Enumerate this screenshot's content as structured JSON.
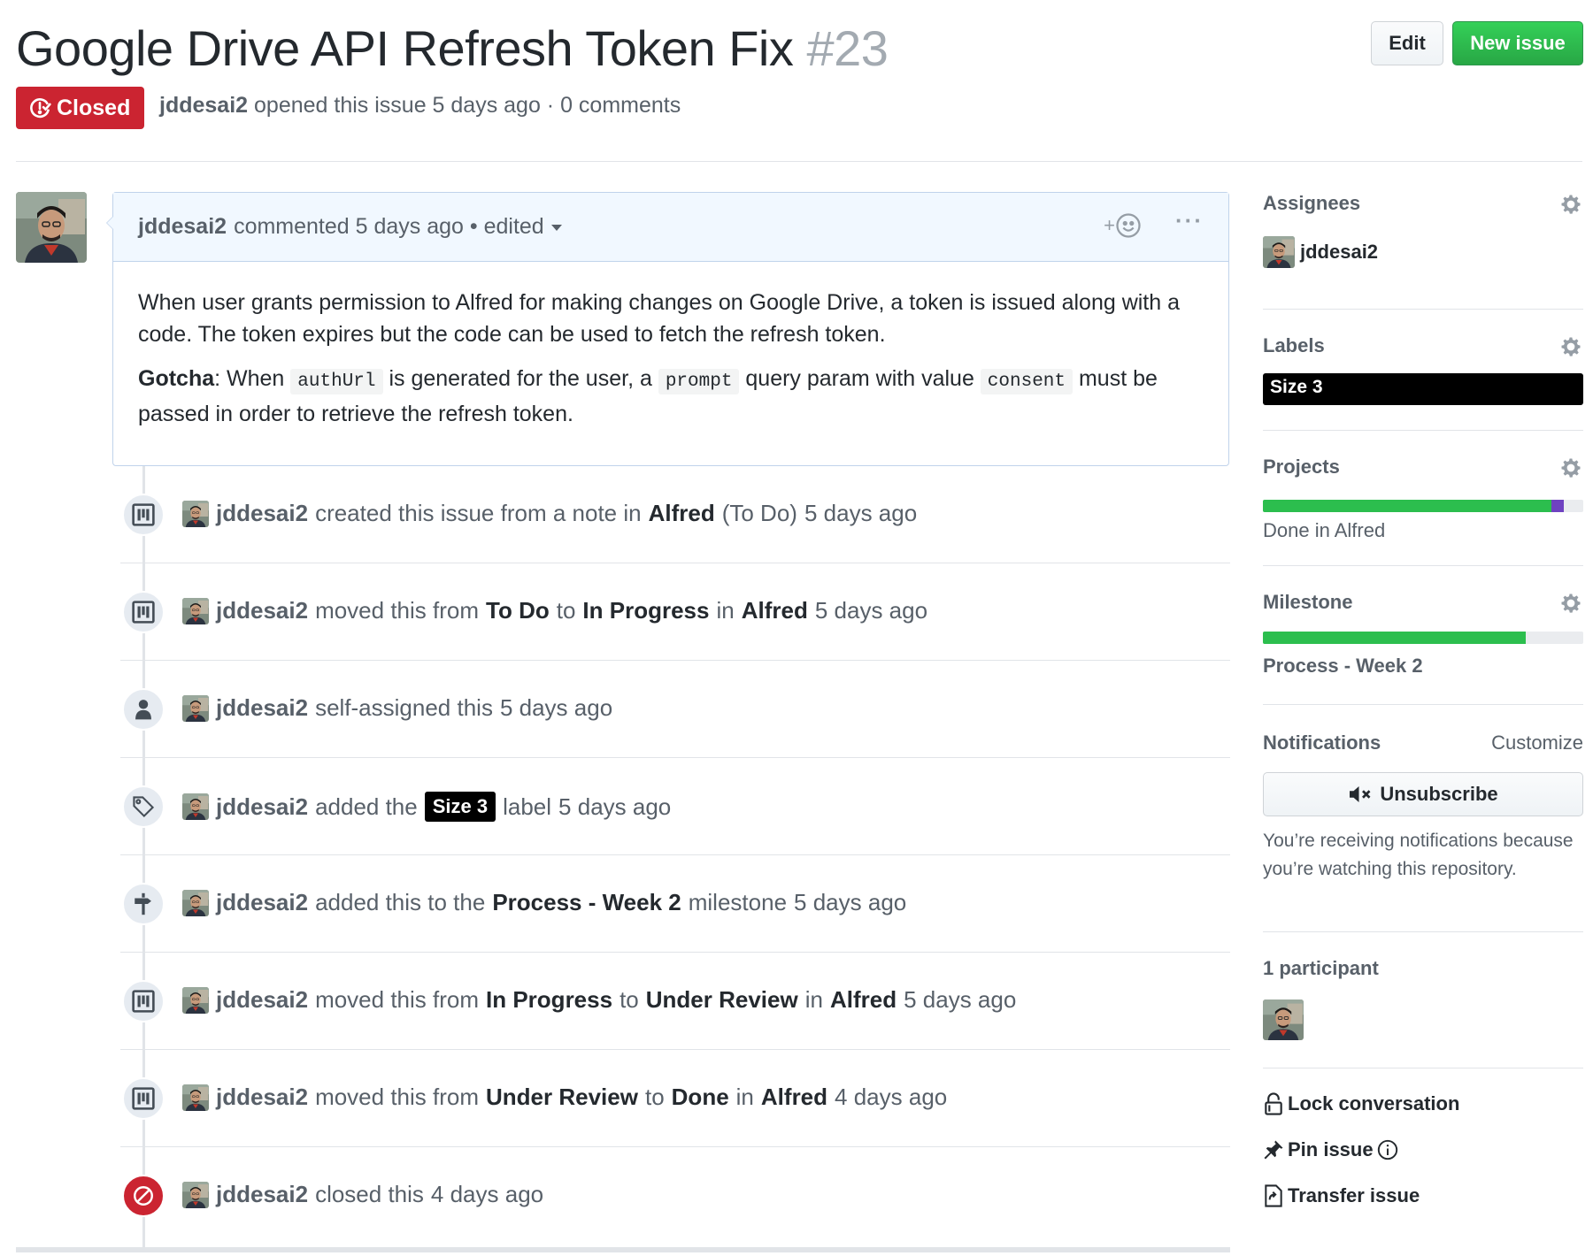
{
  "issue": {
    "title": "Google Drive API Refresh Token Fix",
    "number": "#23",
    "state": "Closed",
    "author": "jddesai2",
    "opened_text": "opened this issue 5 days ago · 0 comments"
  },
  "header_actions": {
    "edit_label": "Edit",
    "new_issue_label": "New issue"
  },
  "comment": {
    "author": "jddesai2",
    "meta": "commented 5 days ago • edited",
    "add_reaction": "+",
    "more": "···",
    "p1": "When user grants permission to Alfred for making changes on Google Drive, a token is issued along with a code. The token expires but the code can be used to fetch the refresh token.",
    "p2_bold": "Gotcha",
    "p2_a": ": When ",
    "p2_code1": "authUrl",
    "p2_b": " is generated for the user, a ",
    "p2_code2": "prompt",
    "p2_c": " query param with value ",
    "p2_code3": "consent",
    "p2_d": " must be passed in order to retrieve the refresh token."
  },
  "timeline": [
    {
      "icon": "project-icon",
      "user": "jddesai2",
      "t1": "created this issue from a note in",
      "b1": "Alfred",
      "t2": "(To Do)",
      "time": "5 days ago"
    },
    {
      "icon": "project-icon",
      "user": "jddesai2",
      "t1": "moved this from",
      "b1": "To Do",
      "t2": "to",
      "b2": "In Progress",
      "t3": "in",
      "b3": "Alfred",
      "time": "5 days ago"
    },
    {
      "icon": "person-icon",
      "user": "jddesai2",
      "t1": "self-assigned this",
      "time": "5 days ago"
    },
    {
      "icon": "tag-icon",
      "user": "jddesai2",
      "t1": "added the",
      "label": "Size 3",
      "t2": "label",
      "time": "5 days ago"
    },
    {
      "icon": "milestone-icon",
      "user": "jddesai2",
      "t1": "added this to the",
      "b1": "Process - Week 2",
      "t2": "milestone",
      "time": "5 days ago"
    },
    {
      "icon": "project-icon",
      "user": "jddesai2",
      "t1": "moved this from",
      "b1": "In Progress",
      "t2": "to",
      "b2": "Under Review",
      "t3": "in",
      "b3": "Alfred",
      "time": "5 days ago"
    },
    {
      "icon": "project-icon",
      "user": "jddesai2",
      "t1": "moved this from",
      "b1": "Under Review",
      "t2": "to",
      "b2": "Done",
      "t3": "in",
      "b3": "Alfred",
      "time": "4 days ago"
    },
    {
      "icon": "circle-slash-icon",
      "user": "jddesai2",
      "t1": "closed this",
      "time": "4 days ago"
    }
  ],
  "sidebar": {
    "assignees": {
      "title": "Assignees",
      "user": "jddesai2"
    },
    "labels": {
      "title": "Labels",
      "label": "Size 3",
      "color": "#000000"
    },
    "projects": {
      "title": "Projects",
      "status": "Done in Alfred",
      "done_fraction": 0.9,
      "in_progress_fraction": 0.04
    },
    "milestone": {
      "title": "Milestone",
      "name": "Process - Week 2",
      "progress_fraction": 0.82
    },
    "notifications": {
      "title": "Notifications",
      "customize": "Customize",
      "button": "Unsubscribe",
      "reason": "You’re receiving notifications because you’re watching this repository."
    },
    "participants": {
      "title": "1 participant"
    },
    "actions": {
      "lock": "Lock conversation",
      "pin": "Pin issue",
      "transfer": "Transfer issue"
    }
  },
  "colors": {
    "closed": "#cb2431",
    "green": "#2cbe4e",
    "purple": "#6f42c1",
    "link_blue_bg": "#f1f8ff"
  }
}
